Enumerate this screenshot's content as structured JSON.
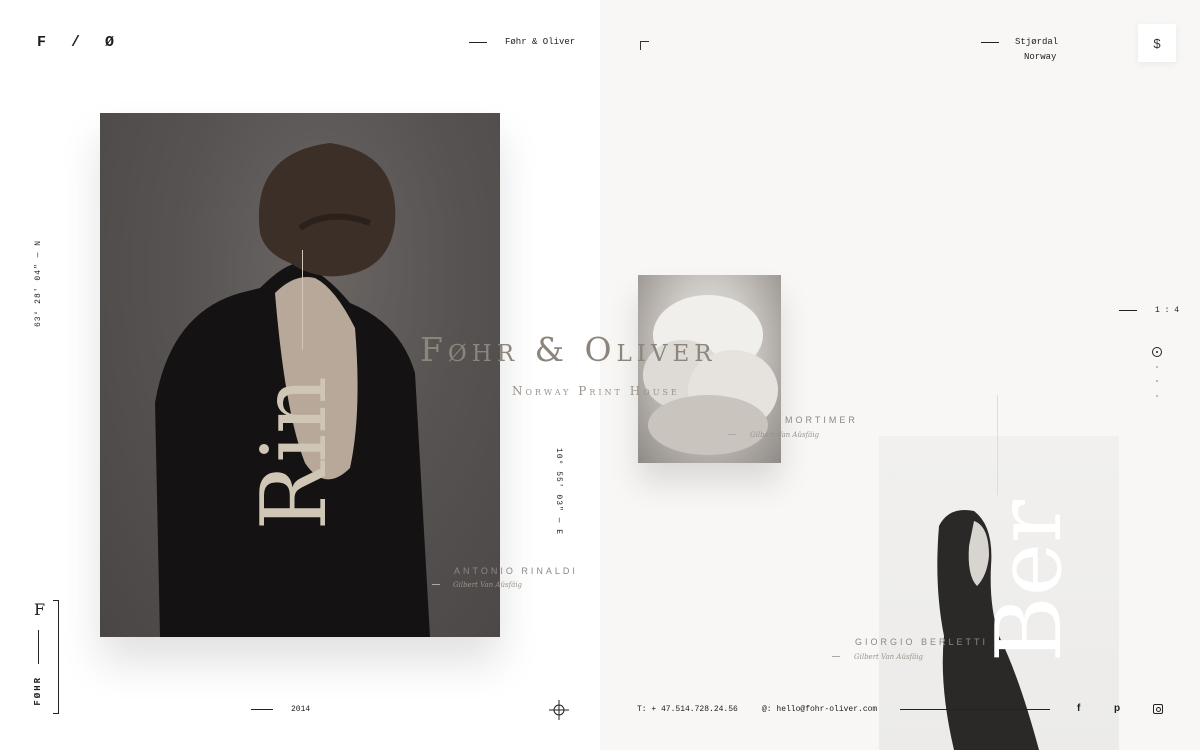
{
  "header": {
    "logo": "F / Ø",
    "brand": "Føhr & Oliver",
    "location_city": "Stjørdal",
    "location_country": "Norway",
    "menu_icon": "dollar-s-icon"
  },
  "side": {
    "coord_left": "63° 28' 04\" — N",
    "coord_mid": "10° 55' 03\" — E",
    "ratio": "1 : 4",
    "vertical_brand": "FØHR",
    "vertical_initial": "F"
  },
  "hero": {
    "title": "Føhr & Oliver",
    "subtitle": "Norway Print House"
  },
  "works": [
    {
      "word": "Rin",
      "name": "ANTONIO RINALDI",
      "sub": "Gilbert Van Aüsfäig"
    },
    {
      "word": "",
      "name": "MORTIMER",
      "sub": "Gilbert Van Aüsfäig"
    },
    {
      "word": "Ber",
      "name": "GIORGIO BERLETTI",
      "sub": "Gilbert Van Aüsfäig"
    }
  ],
  "footer": {
    "year": "2014",
    "phone": "T: + 47.514.728.24.56",
    "email": "@: hello@fohr-oliver.com",
    "social": [
      "f",
      "p",
      "ig"
    ]
  }
}
